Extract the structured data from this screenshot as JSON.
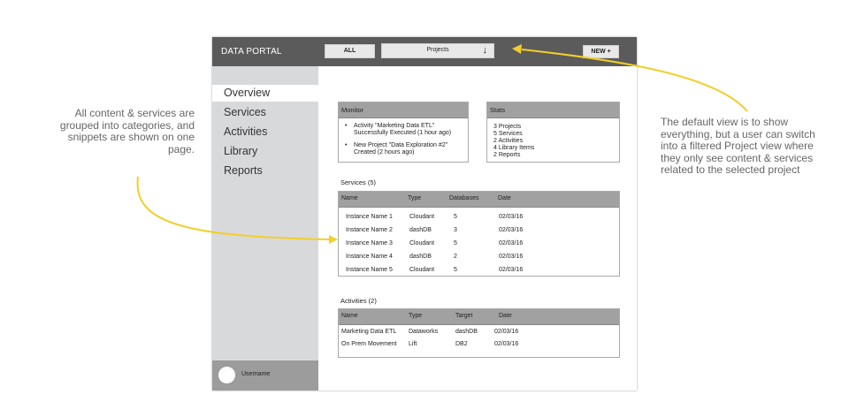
{
  "annotations": {
    "left": "All content & services are grouped into categories, and snippets  are shown on one page.",
    "right": "The default view is to show everything, but a user can switch into a filtered Project view where they only see content & services related to the selected project"
  },
  "topbar": {
    "brand": "DATA PORTAL",
    "all_label": "ALL",
    "projects_label": "Projects",
    "projects_arrow": "↓",
    "new_label": "NEW +"
  },
  "sidebar": {
    "items": [
      {
        "label": "Overview"
      },
      {
        "label": "Services"
      },
      {
        "label": "Activities"
      },
      {
        "label": "Library"
      },
      {
        "label": "Reports"
      }
    ],
    "username": "Username"
  },
  "monitor": {
    "title": "Monitor",
    "items": [
      {
        "bullet": "•",
        "text": "Activity \"Marketing Data ETL\" Successfully Executed (1 hour ago)"
      },
      {
        "bullet": "•",
        "text": "New Project \"Data Exploration #2\" Created (2 hours ago)"
      }
    ]
  },
  "stats": {
    "title": "Stats",
    "lines": [
      "3 Projects",
      "5 Services",
      "2 Activities",
      "4 Library Items",
      "2 Reports"
    ]
  },
  "services": {
    "title": "Services (5)",
    "columns": [
      "Name",
      "Type",
      "Databases",
      "Date"
    ],
    "rows": [
      [
        "Instance Name 1",
        "Cloudant",
        "5",
        "02/03/16"
      ],
      [
        "Instance Name 2",
        "dashDB",
        "3",
        "02/03/16"
      ],
      [
        "Instance Name 3",
        "Cloudant",
        "5",
        "02/03/16"
      ],
      [
        "Instance Name 4",
        "dashDB",
        "2",
        "02/03/16"
      ],
      [
        "Instance Name 5",
        "Cloudant",
        "5",
        "02/03/16"
      ]
    ]
  },
  "activities": {
    "title": "Activities (2)",
    "columns": [
      "Name",
      "Type",
      "Target",
      "Date"
    ],
    "rows": [
      [
        "Marketing Data ETL",
        "Dataworks",
        "dashDB",
        "02/03/16"
      ],
      [
        "On Prem Movement",
        "Lift",
        "DB2",
        "02/03/16"
      ]
    ]
  },
  "colors": {
    "topbar": "#5b5b5b",
    "sidebar": "#d8d9db",
    "arrow": "#f2cf2a"
  }
}
